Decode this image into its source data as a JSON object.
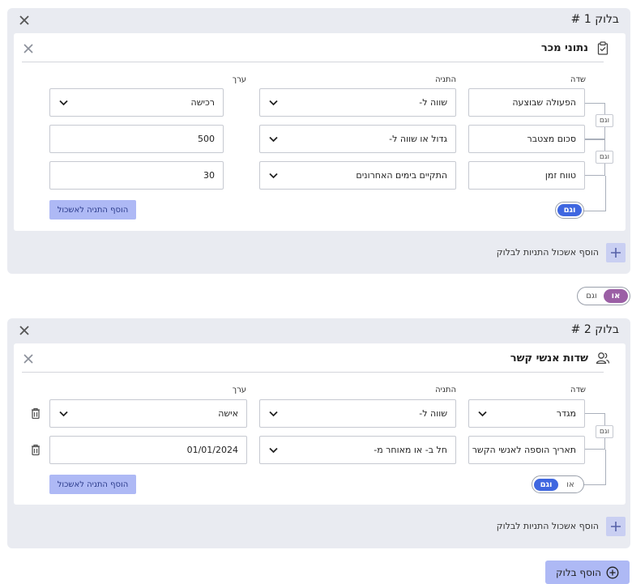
{
  "colors": {
    "panel_bg": "#e9ebf1",
    "primary": "#aeb9f5",
    "and_toggle_active": "#3f67e0",
    "or_toggle_active": "#9b5fa5"
  },
  "blocks": [
    {
      "title": "בלוק 1 #",
      "card": {
        "title": "נתוני מכר",
        "icon": "clipboard-check-icon",
        "columns": {
          "field": "שדה",
          "condition": "התניה",
          "value": "ערך"
        },
        "rows": [
          {
            "field": "הפעולה שבוצעה",
            "condition": "שווה ל-",
            "value": "רכישה",
            "value_type": "select"
          },
          {
            "field": "סכום מצטבר",
            "condition": "גדול או שווה ל-",
            "value": "500",
            "value_type": "input"
          },
          {
            "field": "טווח זמן",
            "condition": "התקיים בימים האחרונים",
            "value": "30",
            "value_type": "input"
          }
        ],
        "and_labels": [
          "וגם",
          "וגם"
        ],
        "toggle": {
          "active": "וגם"
        },
        "add_condition": "הוסף התניה לאשכול"
      },
      "add_group": "הוסף אשכול התניות לבלוק"
    },
    {
      "title": "בלוק 2 #",
      "card": {
        "title": "שדות אנשי קשר",
        "icon": "users-icon",
        "columns": {
          "field": "שדה",
          "condition": "התניה",
          "value": "ערך"
        },
        "rows": [
          {
            "field": "מגדר",
            "condition": "שווה ל-",
            "value": "אישה",
            "value_type": "select"
          },
          {
            "field": "תאריך הוספה לאנשי הקשר",
            "condition": "חל ב- או מאוחר מ-",
            "value": "01/01/2024",
            "value_type": "input"
          }
        ],
        "and_labels": [
          "וגם"
        ],
        "toggle": {
          "active": "וגם",
          "inactive": "או"
        },
        "add_condition": "הוסף התניה לאשכול"
      },
      "add_group": "הוסף אשכול התניות לבלוק"
    }
  ],
  "block_connector": {
    "active": "או",
    "inactive": "וגם"
  },
  "add_block": "הוסף בלוק"
}
